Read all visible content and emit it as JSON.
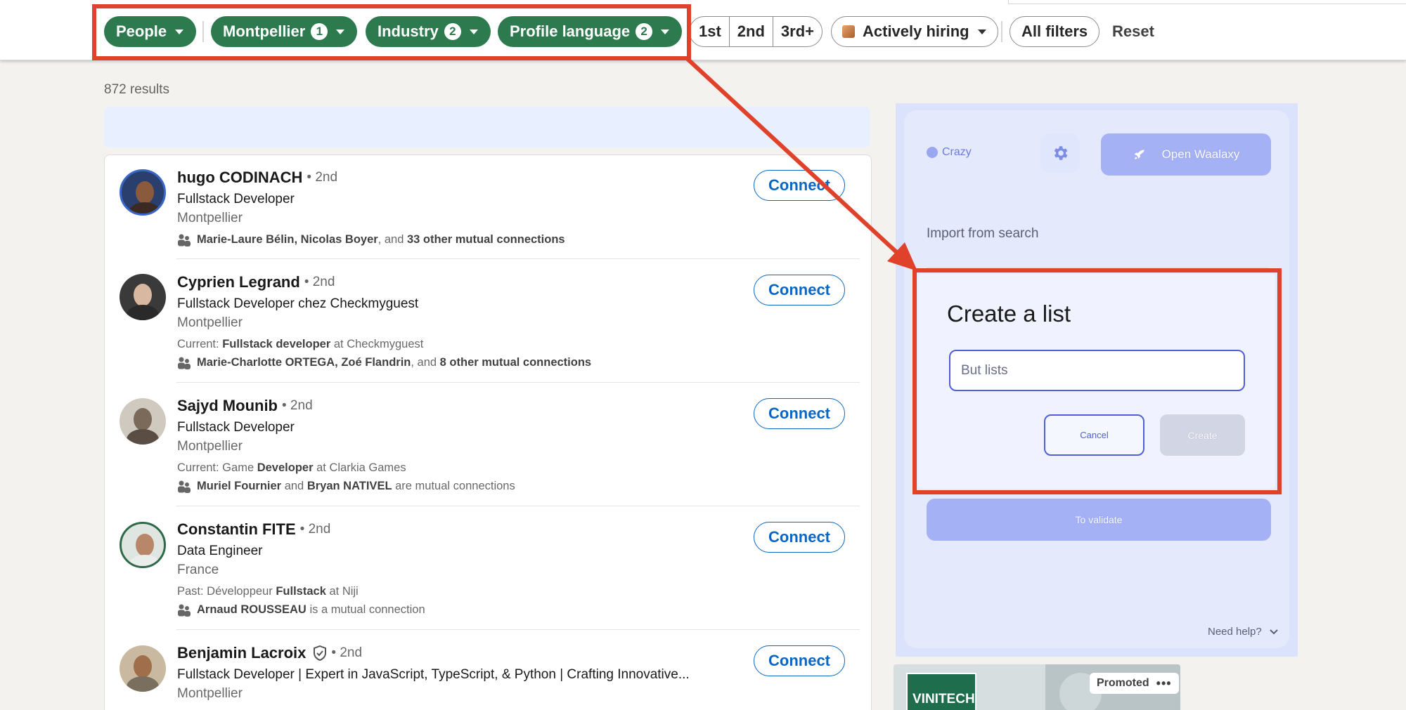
{
  "filters": {
    "people": "People",
    "location": "Montpellier",
    "location_count": "1",
    "industry": "Industry",
    "industry_count": "2",
    "profile_language": "Profile language",
    "profile_language_count": "2",
    "degree_1": "1st",
    "degree_2": "2nd",
    "degree_3": "3rd+",
    "actively_hiring": "Actively hiring",
    "all_filters": "All filters",
    "reset": "Reset"
  },
  "results_count": "872 results",
  "results": [
    {
      "name": "hugo CODINACH",
      "degree": "• 2nd",
      "headline": "Fullstack Developer",
      "location": "Montpellier",
      "mutual_names": "Marie-Laure Bélin, Nicolas Boyer",
      "mutual_sep": ", and",
      "mutual_extra": "33 other mutual connections",
      "connect": "Connect"
    },
    {
      "name": "Cyprien Legrand",
      "degree": "• 2nd",
      "headline": "Fullstack Developer chez Checkmyguest",
      "location": "Montpellier",
      "insight_pre": "Current:",
      "insight_bold": "Fullstack developer",
      "insight_post": "at Checkmyguest",
      "mutual_names": "Marie-Charlotte ORTEGA, Zoé Flandrin",
      "mutual_sep": ", and",
      "mutual_extra": "8 other mutual connections",
      "connect": "Connect"
    },
    {
      "name": "Sajyd Mounib",
      "degree": "• 2nd",
      "headline": "Fullstack Developer",
      "location": "Montpellier",
      "insight_pre": "Current: Game",
      "insight_bold": "Developer",
      "insight_post": "at Clarkia Games",
      "mutual_names": "Muriel Fournier",
      "mutual_sep": "and",
      "mutual_extra": "Bryan NATIVEL",
      "mutual_tail": "are mutual connections",
      "connect": "Connect"
    },
    {
      "name": "Constantin FITE",
      "degree": "• 2nd",
      "headline": "Data Engineer",
      "location": "France",
      "insight_pre": "Past: Développeur",
      "insight_bold": "Fullstack",
      "insight_post": "at Niji",
      "mutual_names": "Arnaud ROUSSEAU",
      "mutual_tail": "is a mutual connection",
      "connect": "Connect"
    },
    {
      "name": "Benjamin Lacroix",
      "degree": "• 2nd",
      "headline": "Fullstack Developer | Expert in JavaScript, TypeScript, & Python | Crafting Innovative...",
      "location": "Montpellier",
      "connect": "Connect"
    }
  ],
  "waalaxy": {
    "account": "Crazy",
    "open_button": "Open Waalaxy",
    "import_label": "Import from search",
    "validate_button": "To validate",
    "help": "Need help?",
    "modal": {
      "title": "Create a list",
      "input_value": "But lists",
      "cancel": "Cancel",
      "create": "Create"
    }
  },
  "promo": {
    "logo_text": "VINITECH",
    "label": "Promoted",
    "more": "•••"
  },
  "colors": {
    "filter_green": "#2e7a4f",
    "linkedin_blue": "#0a66c2",
    "annotation_red": "#e0412a",
    "waalaxy_accent": "#4f60d6"
  }
}
